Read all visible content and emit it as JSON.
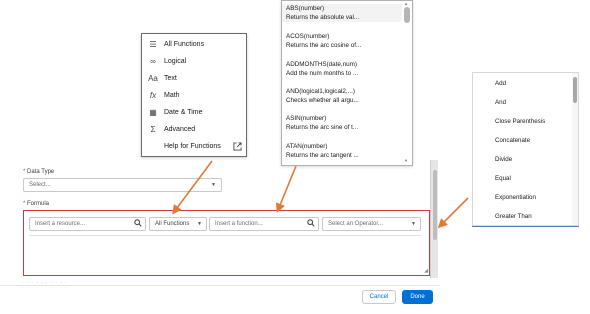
{
  "category_menu": {
    "items": [
      {
        "icon": "list-icon",
        "glyph": "☰",
        "label": "All Functions"
      },
      {
        "icon": "logical-icon",
        "glyph": "∞",
        "label": "Logical"
      },
      {
        "icon": "text-icon",
        "glyph": "Aa",
        "label": "Text"
      },
      {
        "icon": "math-icon",
        "glyph": "fx",
        "label": "Math"
      },
      {
        "icon": "calendar-icon",
        "glyph": "▦",
        "label": "Date & Time"
      },
      {
        "icon": "sigma-icon",
        "glyph": "Σ",
        "label": "Advanced"
      },
      {
        "icon": "",
        "glyph": "",
        "label": "Help for Functions"
      }
    ],
    "help_icon": "external-link-icon"
  },
  "function_list": {
    "items": [
      {
        "name": "ABS(number)",
        "desc": "Returns the absolute val..."
      },
      {
        "name": "ACOS(number)",
        "desc": "Returns the arc cosine of..."
      },
      {
        "name": "ADDMONTHS(date,num)",
        "desc": "Add the num months to ..."
      },
      {
        "name": "AND(logical1,logical2,...)",
        "desc": "Checks whether all argu..."
      },
      {
        "name": "ASIN(number)",
        "desc": "Returns the arc sine of t..."
      },
      {
        "name": "ATAN(number)",
        "desc": "Returns the arc tangent ..."
      }
    ]
  },
  "operator_list": {
    "items": [
      "Add",
      "And",
      "Close Parenthesis",
      "Concatenate",
      "Divide",
      "Equal",
      "Exponentiation",
      "Greater Than"
    ]
  },
  "form": {
    "data_type_label": "Data Type",
    "data_type_placeholder": "Select...",
    "formula_label": "Formula",
    "resource_placeholder": "Insert a resource...",
    "category_value": "All Functions",
    "function_placeholder": "Insert a function...",
    "operator_placeholder": "Select an Operator..."
  },
  "buttons": {
    "cancel": "Cancel",
    "done": "Done"
  },
  "colors": {
    "accent": "#0070d2",
    "error_border": "#d1383a",
    "arrow": "#e07a3a"
  }
}
